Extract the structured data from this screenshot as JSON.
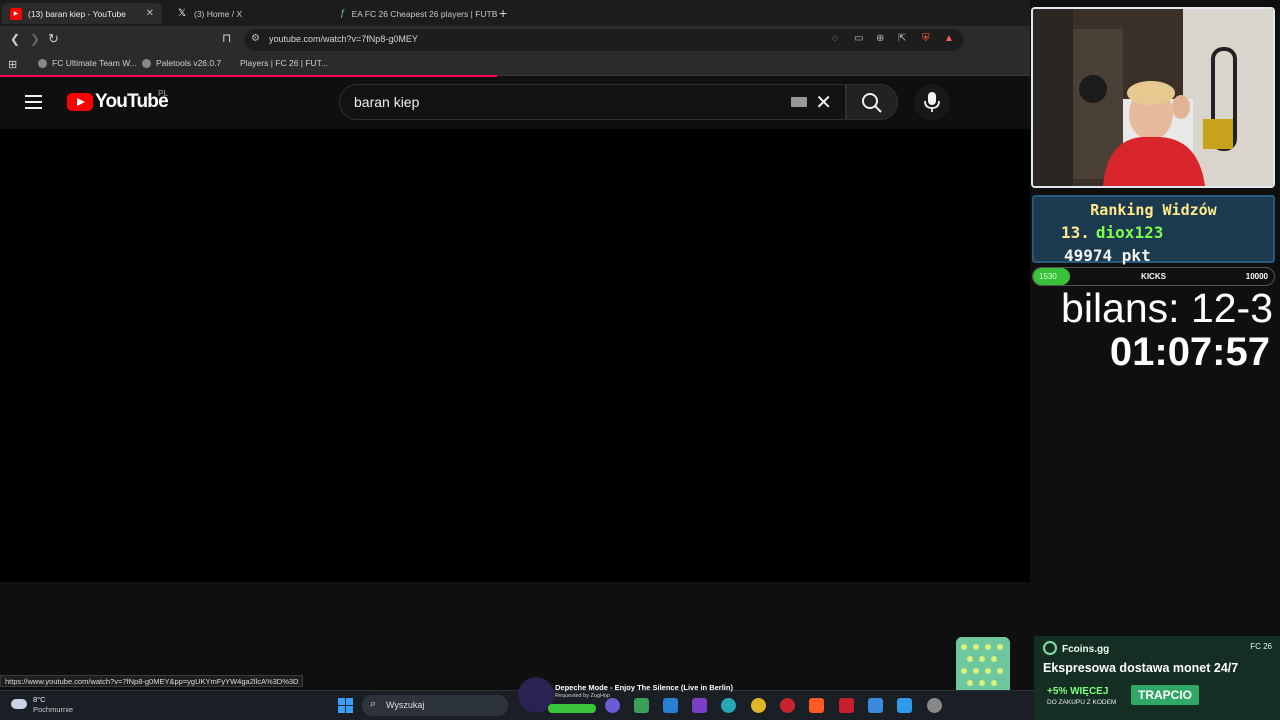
{
  "browser": {
    "tabs": [
      {
        "label": "(13) baran kiep - YouTube",
        "icon": "youtube-icon",
        "active": true
      },
      {
        "label": "(3) Home / X",
        "icon": "x-icon",
        "active": false
      },
      {
        "label": "EA FC 26 Cheapest 26 players | FUTB",
        "icon": "futbin-icon",
        "active": false
      }
    ],
    "new_tab": "+",
    "url": "youtube.com/watch?v=7fNp8-g0MEY",
    "bookmarks": [
      "FC Ultimate Team W...",
      "Paletools v26.0.7",
      "Players | FC 26 | FUT..."
    ],
    "status_url": "https://www.youtube.com/watch?v=7fNp8-g0MEY&pp=ygUKYmFyYW4ga2llcA%3D%3D"
  },
  "youtube": {
    "wordmark": "YouTube",
    "country": "PL",
    "search_value": "baran kiep"
  },
  "overlay": {
    "ranking_title": "Ranking Widzów",
    "ranking_position": "13.",
    "ranking_name": "diox123",
    "ranking_points": "49974 pkt",
    "kicks_current": "1530",
    "kicks_label": "KICKS",
    "kicks_goal": "10000",
    "kicks_progress": 0.153,
    "bilans": "bilans: 12-3",
    "timer": "01:07:57"
  },
  "ad": {
    "brand": "Fcoins.gg",
    "tag": "FC 26",
    "headline": "Ekspresowa dostawa monet 24/7",
    "more": "+5% WIĘCEJ",
    "more_sub": "DO ZAKUPU Z KODEM",
    "code": "TRAPCIO"
  },
  "music": {
    "title": "Depeche Mode - Enjoy The Silence (Live in Berlin)",
    "requested_by": "Requested by ZugHop"
  },
  "taskbar": {
    "temperature": "8°C",
    "weather": "Pochmurnie",
    "search_placeholder": "Wyszukaj"
  },
  "colors": {
    "youtube_red": "#ff0000",
    "load_bar": "#ff0050",
    "kicks_green": "#37c23a",
    "ranking_name": "#7dff4a",
    "ranking_title": "#ffe98a"
  }
}
